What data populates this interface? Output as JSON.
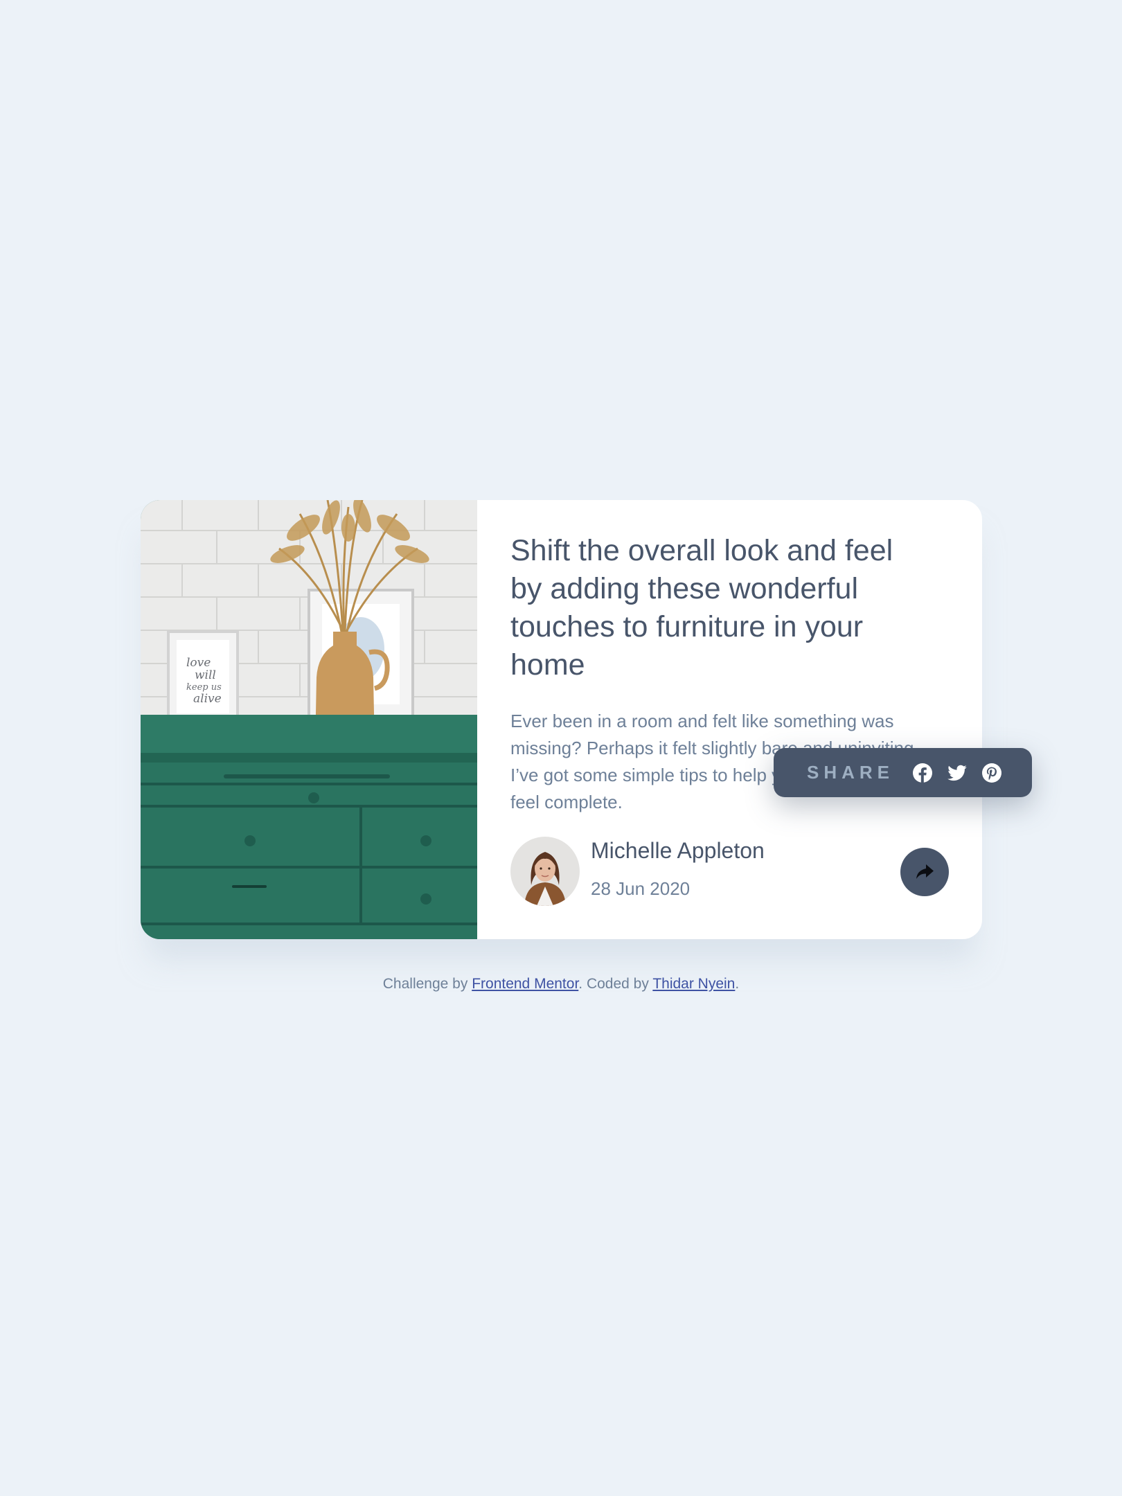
{
  "article": {
    "title": "Shift the overall look and feel by adding these wonderful touches to furniture in your home",
    "description": "Ever been in a room and felt like something was missing? Perhaps it felt slightly bare and uninviting. I’ve got some simple tips to help you make any room feel complete."
  },
  "author": {
    "name": "Michelle Appleton",
    "date": "28 Jun 2020"
  },
  "share": {
    "label": "SHARE",
    "icons": [
      "facebook-icon",
      "twitter-icon",
      "pinterest-icon",
      "share-arrow-icon"
    ]
  },
  "footer": {
    "prefix": "Challenge by ",
    "link1": "Frontend Mentor",
    "middle": ". Coded by ",
    "link2": "Thidar Nyein",
    "suffix": "."
  },
  "colors": {
    "background": "#ecf2f8",
    "card": "#ffffff",
    "heading": "#48556a",
    "body_text": "#6e8098",
    "share_panel": "#48556a",
    "share_label": "#9eafc2",
    "link": "#3e52a3"
  }
}
